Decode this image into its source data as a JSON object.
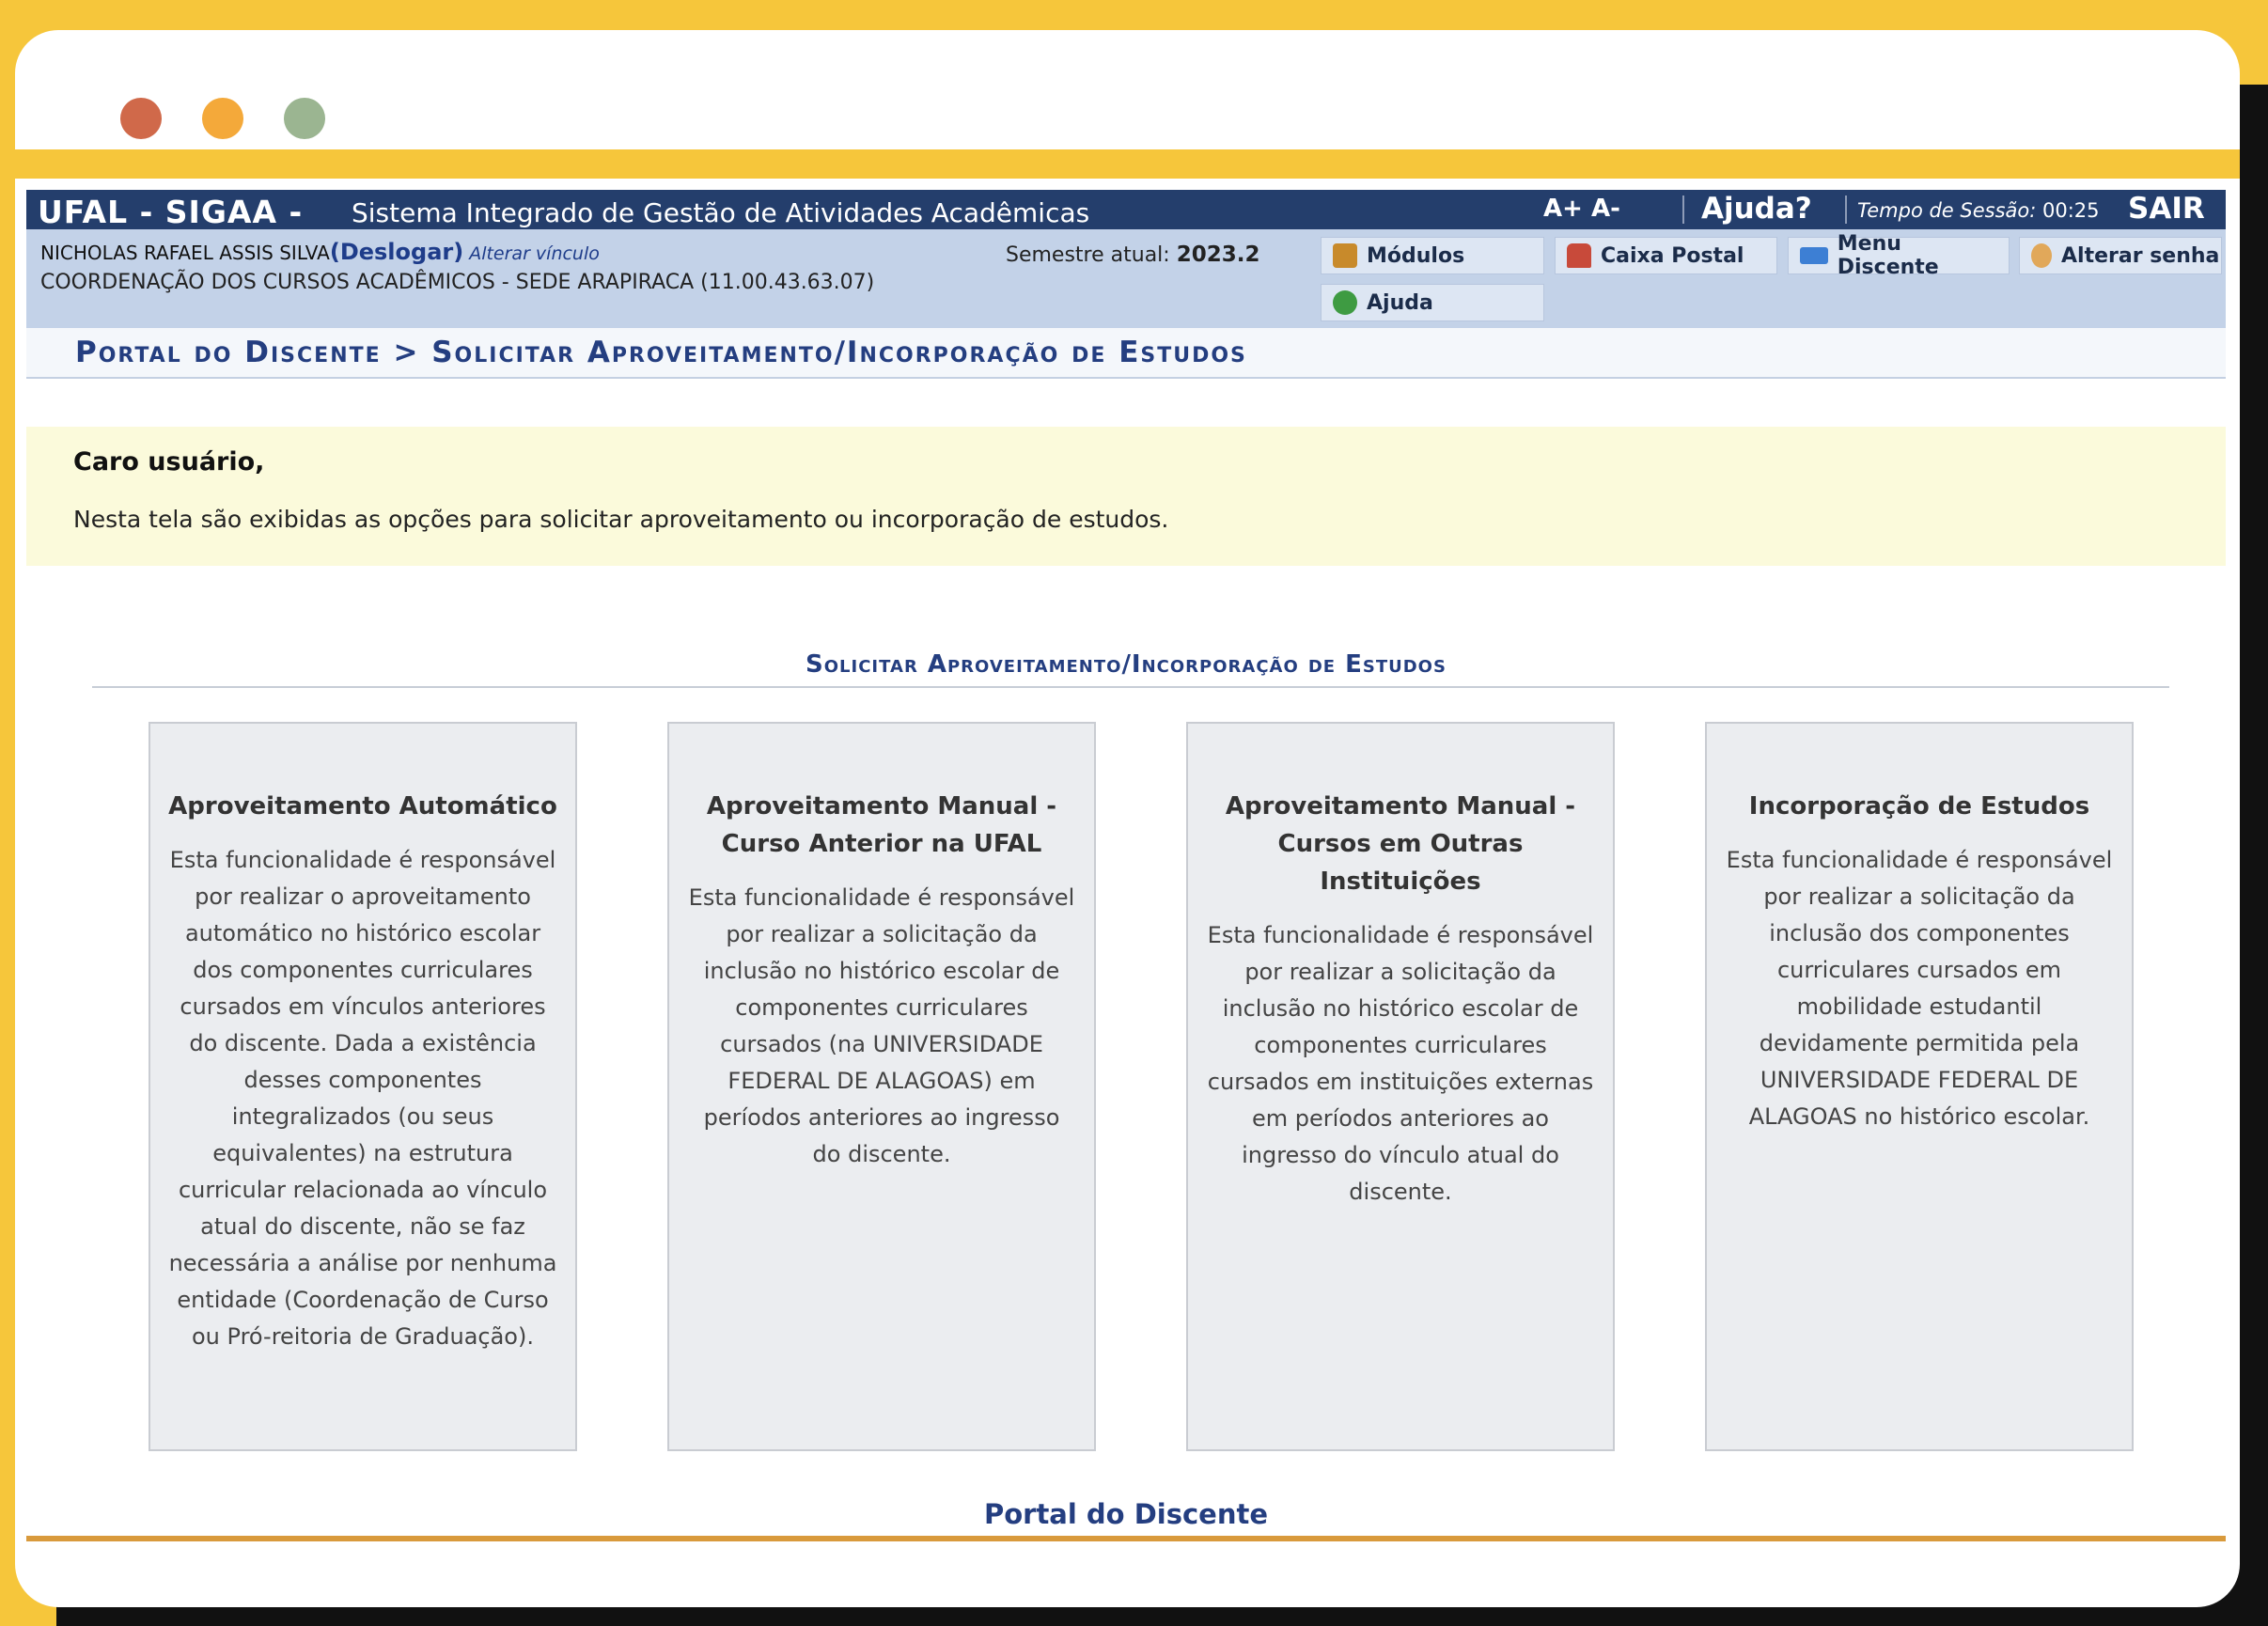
{
  "header": {
    "brand": "UFAL - SIGAA -",
    "system_name": "Sistema Integrado de Gestão de Atividades Acadêmicas",
    "font_controls": "A+ A-",
    "help": "Ajuda?",
    "session_label": "Tempo de Sessão:",
    "session_time": "00:25",
    "logout": "SAIR"
  },
  "user_bar": {
    "user_name": "NICHOLAS RAFAEL ASSIS SILVA",
    "logout_link": "(Deslogar)",
    "change_link": "Alterar vínculo",
    "unit": "COORDENAÇÃO DOS CURSOS ACADÊMICOS - SEDE ARAPIRACA (11.00.43.63.07)",
    "semester_label": "Semestre atual:",
    "semester_value": "2023.2"
  },
  "menu": {
    "modulos": "Módulos",
    "caixa_postal": "Caixa Postal",
    "menu_discente": "Menu Discente",
    "alterar_senha": "Alterar senha",
    "ajuda": "Ajuda"
  },
  "breadcrumb": "Portal do Discente > Solicitar Aproveitamento/Incorporação de Estudos",
  "notice": {
    "title": "Caro usuário,",
    "text": "Nesta tela são exibidas as opções para solicitar aproveitamento ou incorporação de estudos."
  },
  "section_title": "Solicitar Aproveitamento/Incorporação de Estudos",
  "cards": [
    {
      "title": "Aproveitamento Automático",
      "text": "Esta funcionalidade é responsável por realizar o aproveitamento automático no histórico escolar dos componentes curriculares cursados em vínculos anteriores do discente. Dada a existência desses componentes integralizados (ou seus equivalentes) na estrutura curricular relacionada ao vínculo atual do discente, não se faz necessária a análise por nenhuma entidade (Coordenação de Curso ou Pró-reitoria de Graduação)."
    },
    {
      "title": "Aproveitamento Manual - Curso Anterior na UFAL",
      "text": "Esta funcionalidade é responsável por realizar a solicitação da inclusão no histórico escolar de componentes curriculares cursados (na UNIVERSIDADE FEDERAL DE ALAGOAS) em períodos anteriores ao ingresso do discente."
    },
    {
      "title": "Aproveitamento Manual - Cursos em Outras Instituições",
      "text": "Esta funcionalidade é responsável por realizar a solicitação da inclusão no histórico escolar de componentes curriculares cursados em instituições externas em períodos anteriores ao ingresso do vínculo atual do discente."
    },
    {
      "title": "Incorporação de Estudos",
      "text": "Esta funcionalidade é responsável por realizar a solicitação da inclusão dos componentes curriculares cursados em mobilidade estudantil devidamente permitida pela UNIVERSIDADE FEDERAL DE ALAGOAS no histórico escolar."
    }
  ],
  "footer": "Portal do Discente"
}
